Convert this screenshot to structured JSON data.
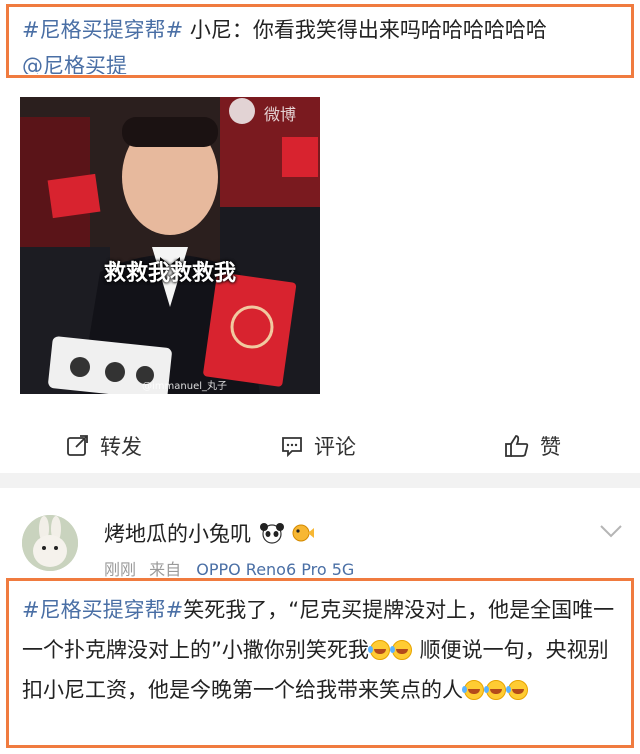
{
  "post": {
    "hashtag": "#尼格买提穿帮#",
    "text": " 小尼：你看我笑得出来吗哈哈哈哈哈哈",
    "mention": "@尼格买提"
  },
  "image": {
    "caption": "救救我救救我",
    "watermark": "@immanuel_丸子",
    "corner_watermark": "微博"
  },
  "actions": {
    "repost": "转发",
    "comment": "评论",
    "like": "赞"
  },
  "commenter": {
    "name": "烤地瓜的小兔叽",
    "time": "刚刚",
    "from": "来自",
    "device": "OPPO Reno6 Pro 5G"
  },
  "comment": {
    "hashtag": "#尼格买提穿帮#",
    "text": "笑死我了，“尼克买提牌没对上，他是全国唯一一个扑克牌没对上的”小撒你别笑死我",
    "text2": " 顺便说一句，央视别扣小尼工资，他是今晚第一个给我带来笑点的人"
  },
  "colors": {
    "highlight": "#f07b3f",
    "link": "#4a6fa5",
    "divider": "#f2f2f2"
  }
}
